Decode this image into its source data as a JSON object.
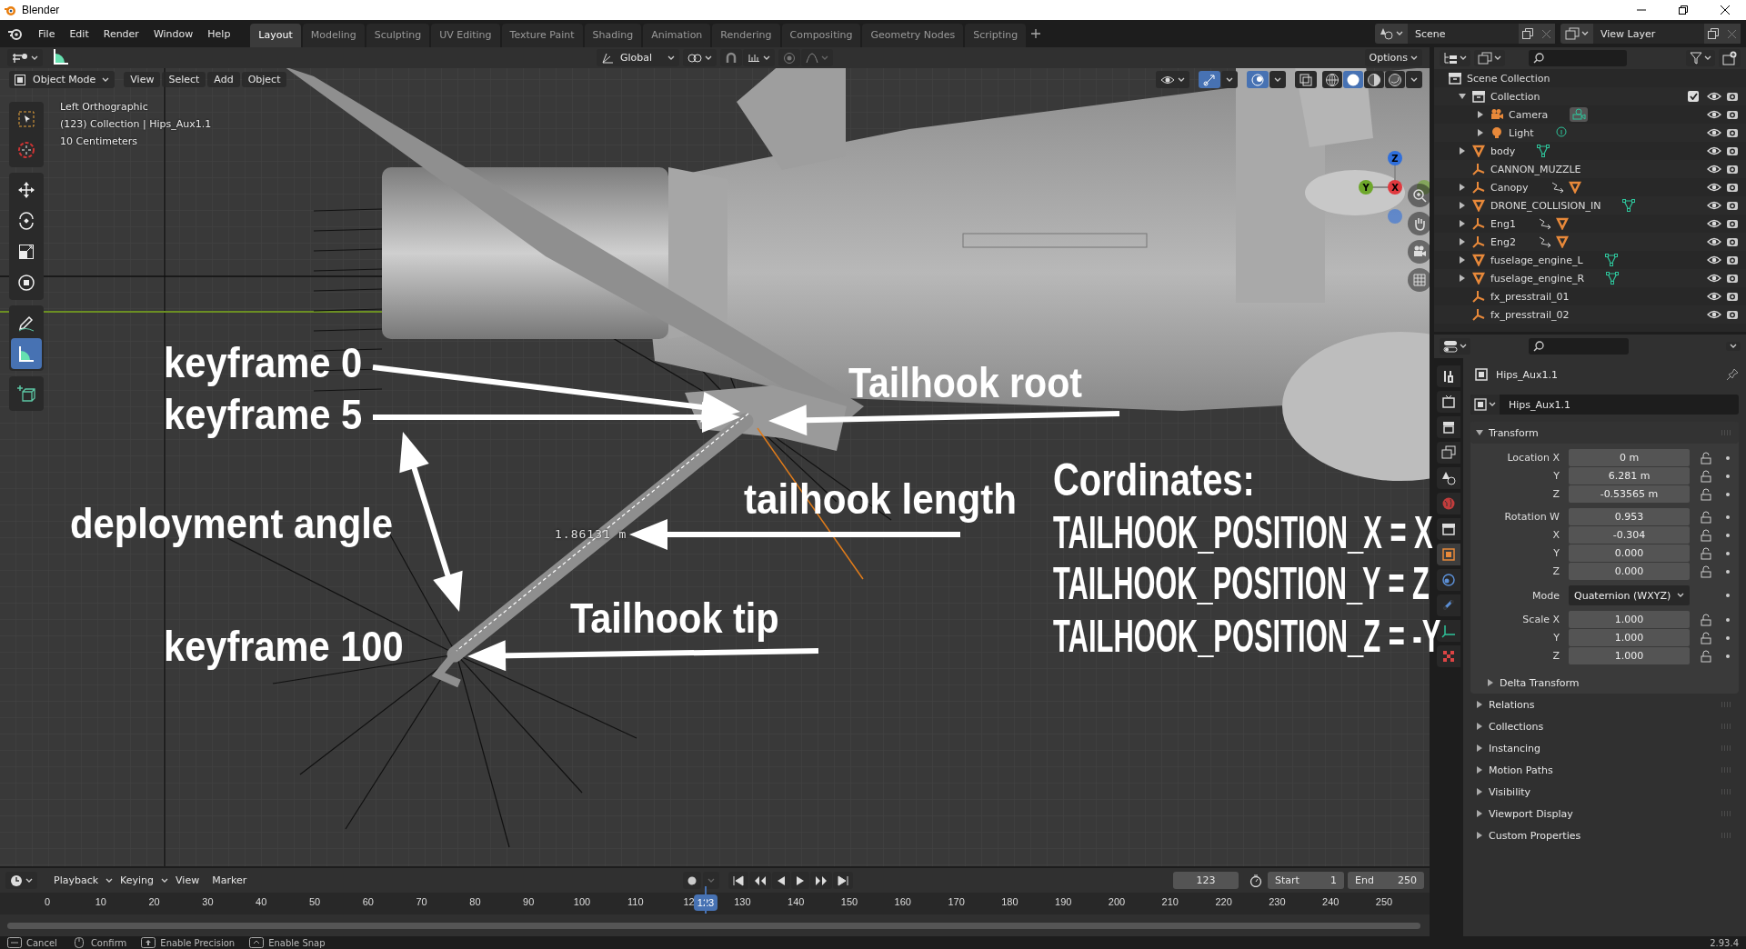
{
  "window": {
    "title": "Blender"
  },
  "menu": [
    "File",
    "Edit",
    "Render",
    "Window",
    "Help"
  ],
  "workspaces": [
    {
      "label": "Layout",
      "selected": true
    },
    {
      "label": "Modeling",
      "selected": false
    },
    {
      "label": "Sculpting",
      "selected": false
    },
    {
      "label": "UV Editing",
      "selected": false
    },
    {
      "label": "Texture Paint",
      "selected": false
    },
    {
      "label": "Shading",
      "selected": false
    },
    {
      "label": "Animation",
      "selected": false
    },
    {
      "label": "Rendering",
      "selected": false
    },
    {
      "label": "Compositing",
      "selected": false
    },
    {
      "label": "Geometry Nodes",
      "selected": false
    },
    {
      "label": "Scripting",
      "selected": false
    }
  ],
  "scene": {
    "scene": "Scene",
    "view_layer": "View Layer"
  },
  "viewport": {
    "orientation": "Global",
    "options": "Options",
    "mode": "Object Mode",
    "menus": [
      "View",
      "Select",
      "Add",
      "Object"
    ],
    "info": [
      "Left Orthographic",
      "(123) Collection | Hips_Aux1.1",
      "10 Centimeters"
    ],
    "tools": [
      {
        "kind": "select",
        "selected": false
      },
      {
        "kind": "cursor",
        "selected": false
      },
      {
        "kind": "move",
        "selected": false
      },
      {
        "kind": "rotate",
        "selected": false
      },
      {
        "kind": "scale",
        "selected": false
      },
      {
        "kind": "transform",
        "selected": false
      },
      {
        "kind": "annotate",
        "selected": false
      },
      {
        "kind": "measure",
        "selected": true
      },
      {
        "kind": "add_cube",
        "selected": false
      }
    ],
    "shading": [
      {
        "kind": "wireframe",
        "selected": false
      },
      {
        "kind": "solid",
        "selected": true
      },
      {
        "kind": "material",
        "selected": false
      },
      {
        "kind": "rendered",
        "selected": false
      }
    ],
    "gizmo_axes": [
      "Z",
      "Y",
      "X"
    ],
    "measurement": "1.86131 m"
  },
  "annotations": [
    {
      "text": "keyframe 0"
    },
    {
      "text": "Tailhook root"
    },
    {
      "text": "keyframe 5"
    },
    {
      "text": "tailhook length"
    },
    {
      "text": "deployment angle"
    },
    {
      "text": "Tailhook tip"
    },
    {
      "text": "keyframe 100"
    }
  ],
  "coordinates": {
    "title": "Cordinates:",
    "lines": [
      "TAILHOOK_POSITION_X = X",
      "TAILHOOK_POSITION_Y = Z",
      "TAILHOOK_POSITION_Z = -Y"
    ]
  },
  "outliner": {
    "root": "Scene Collection",
    "items": [
      {
        "name": "Collection",
        "kind": "collection",
        "expanded": true,
        "checked": true,
        "children": [
          {
            "name": "Camera",
            "kind": "camera",
            "expanded": false,
            "badges": [
              {
                "kind": "camera"
              }
            ]
          },
          {
            "name": "Light",
            "kind": "light",
            "expanded": false,
            "badges": [
              {
                "kind": "light"
              }
            ]
          }
        ]
      },
      {
        "name": "body",
        "kind": "mesh",
        "expanded": false,
        "badges": [
          {
            "kind": "mesh"
          }
        ]
      },
      {
        "name": "CANNON_MUZZLE",
        "kind": "empty"
      },
      {
        "name": "Canopy",
        "kind": "empty",
        "expanded": false,
        "badges": [
          {
            "kind": "parent"
          },
          {
            "kind": "child_mesh"
          }
        ]
      },
      {
        "name": "DRONE_COLLISION_IN",
        "kind": "mesh",
        "expanded": false,
        "badges": [
          {
            "kind": "mesh"
          }
        ]
      },
      {
        "name": "Eng1",
        "kind": "empty",
        "expanded": false,
        "badges": [
          {
            "kind": "parent"
          },
          {
            "kind": "child_mesh"
          }
        ]
      },
      {
        "name": "Eng2",
        "kind": "empty",
        "expanded": false,
        "badges": [
          {
            "kind": "parent"
          },
          {
            "kind": "child_mesh"
          }
        ]
      },
      {
        "name": "fuselage_engine_L",
        "kind": "mesh",
        "expanded": false,
        "badges": [
          {
            "kind": "mesh"
          }
        ]
      },
      {
        "name": "fuselage_engine_R",
        "kind": "mesh",
        "expanded": false,
        "badges": [
          {
            "kind": "mesh"
          }
        ]
      },
      {
        "name": "fx_presstrail_01",
        "kind": "empty"
      },
      {
        "name": "fx_presstrail_02",
        "kind": "empty"
      }
    ]
  },
  "properties": {
    "tabs": [
      {
        "kind": "tool",
        "selected": false
      },
      {
        "kind": "render",
        "selected": false
      },
      {
        "kind": "output",
        "selected": false
      },
      {
        "kind": "view_layer",
        "selected": false
      },
      {
        "kind": "scene",
        "selected": false
      },
      {
        "kind": "world",
        "selected": false
      },
      {
        "kind": "collection",
        "selected": false
      },
      {
        "kind": "object",
        "selected": true
      },
      {
        "kind": "physics",
        "selected": false
      },
      {
        "kind": "constraints",
        "selected": false
      },
      {
        "kind": "data",
        "selected": false
      },
      {
        "kind": "texture",
        "selected": false
      }
    ],
    "object": "Hips_Aux1.1",
    "name": "Hips_Aux1.1",
    "transform": {
      "title": "Transform",
      "expanded": true,
      "groups": [
        [
          {
            "kind": "number",
            "label": "Location X",
            "value": "0 m"
          },
          {
            "kind": "number",
            "label": "Y",
            "value": "6.281 m"
          },
          {
            "kind": "number",
            "label": "Z",
            "value": "-0.53565 m"
          }
        ],
        [
          {
            "kind": "number",
            "label": "Rotation W",
            "value": "0.953"
          },
          {
            "kind": "number",
            "label": "X",
            "value": "-0.304"
          },
          {
            "kind": "number",
            "label": "Y",
            "value": "0.000"
          },
          {
            "kind": "number",
            "label": "Z",
            "value": "0.000"
          }
        ],
        [
          {
            "kind": "dropdown",
            "label": "Mode",
            "value": "Quaternion (WXYZ)"
          }
        ],
        [
          {
            "kind": "number",
            "label": "Scale X",
            "value": "1.000"
          },
          {
            "kind": "number",
            "label": "Y",
            "value": "1.000"
          },
          {
            "kind": "number",
            "label": "Z",
            "value": "1.000"
          }
        ]
      ],
      "subpanels": [
        {
          "title": "Delta Transform",
          "expanded": false
        }
      ]
    },
    "panels": [
      {
        "title": "Relations",
        "expanded": false
      },
      {
        "title": "Collections",
        "expanded": false
      },
      {
        "title": "Instancing",
        "expanded": false
      },
      {
        "title": "Motion Paths",
        "expanded": false
      },
      {
        "title": "Visibility",
        "expanded": false
      },
      {
        "title": "Viewport Display",
        "expanded": false
      },
      {
        "title": "Custom Properties",
        "expanded": false
      }
    ]
  },
  "timeline": {
    "menus": [
      "Playback",
      "Keying",
      "View",
      "Marker"
    ],
    "frame": "123",
    "start_label": "Start",
    "start": "1",
    "end_label": "End",
    "end": "250",
    "ticks": [
      "0",
      "10",
      "20",
      "30",
      "40",
      "50",
      "60",
      "70",
      "80",
      "90",
      "100",
      "110",
      "12",
      "130",
      "140",
      "150",
      "160",
      "170",
      "180",
      "190",
      "200",
      "210",
      "220",
      "230",
      "240",
      "250"
    ],
    "playhead": "123"
  },
  "status_bar": {
    "hints": [
      {
        "kind": "esc",
        "label": "Cancel"
      },
      {
        "kind": "mouse",
        "label": "Confirm"
      },
      {
        "kind": "shift",
        "label": "Enable Precision"
      },
      {
        "kind": "ctrl",
        "label": "Enable Snap"
      }
    ],
    "version": "2.93.4"
  }
}
